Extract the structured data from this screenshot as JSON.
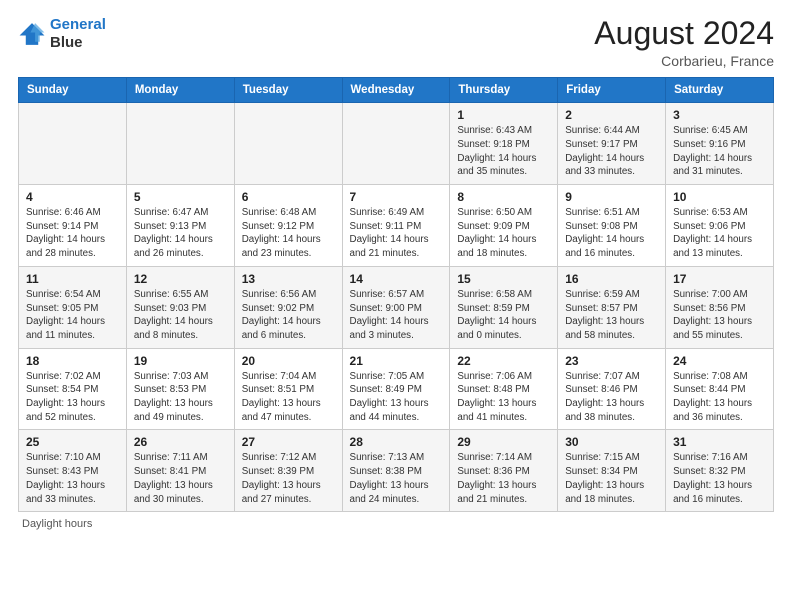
{
  "app": {
    "logo_line1": "General",
    "logo_line2": "Blue"
  },
  "header": {
    "title": "August 2024",
    "subtitle": "Corbarieu, France"
  },
  "weekdays": [
    "Sunday",
    "Monday",
    "Tuesday",
    "Wednesday",
    "Thursday",
    "Friday",
    "Saturday"
  ],
  "footer": {
    "note": "Daylight hours"
  },
  "weeks": [
    [
      {
        "day": "",
        "info": ""
      },
      {
        "day": "",
        "info": ""
      },
      {
        "day": "",
        "info": ""
      },
      {
        "day": "",
        "info": ""
      },
      {
        "day": "1",
        "info": "Sunrise: 6:43 AM\nSunset: 9:18 PM\nDaylight: 14 hours\nand 35 minutes."
      },
      {
        "day": "2",
        "info": "Sunrise: 6:44 AM\nSunset: 9:17 PM\nDaylight: 14 hours\nand 33 minutes."
      },
      {
        "day": "3",
        "info": "Sunrise: 6:45 AM\nSunset: 9:16 PM\nDaylight: 14 hours\nand 31 minutes."
      }
    ],
    [
      {
        "day": "4",
        "info": "Sunrise: 6:46 AM\nSunset: 9:14 PM\nDaylight: 14 hours\nand 28 minutes."
      },
      {
        "day": "5",
        "info": "Sunrise: 6:47 AM\nSunset: 9:13 PM\nDaylight: 14 hours\nand 26 minutes."
      },
      {
        "day": "6",
        "info": "Sunrise: 6:48 AM\nSunset: 9:12 PM\nDaylight: 14 hours\nand 23 minutes."
      },
      {
        "day": "7",
        "info": "Sunrise: 6:49 AM\nSunset: 9:11 PM\nDaylight: 14 hours\nand 21 minutes."
      },
      {
        "day": "8",
        "info": "Sunrise: 6:50 AM\nSunset: 9:09 PM\nDaylight: 14 hours\nand 18 minutes."
      },
      {
        "day": "9",
        "info": "Sunrise: 6:51 AM\nSunset: 9:08 PM\nDaylight: 14 hours\nand 16 minutes."
      },
      {
        "day": "10",
        "info": "Sunrise: 6:53 AM\nSunset: 9:06 PM\nDaylight: 14 hours\nand 13 minutes."
      }
    ],
    [
      {
        "day": "11",
        "info": "Sunrise: 6:54 AM\nSunset: 9:05 PM\nDaylight: 14 hours\nand 11 minutes."
      },
      {
        "day": "12",
        "info": "Sunrise: 6:55 AM\nSunset: 9:03 PM\nDaylight: 14 hours\nand 8 minutes."
      },
      {
        "day": "13",
        "info": "Sunrise: 6:56 AM\nSunset: 9:02 PM\nDaylight: 14 hours\nand 6 minutes."
      },
      {
        "day": "14",
        "info": "Sunrise: 6:57 AM\nSunset: 9:00 PM\nDaylight: 14 hours\nand 3 minutes."
      },
      {
        "day": "15",
        "info": "Sunrise: 6:58 AM\nSunset: 8:59 PM\nDaylight: 14 hours\nand 0 minutes."
      },
      {
        "day": "16",
        "info": "Sunrise: 6:59 AM\nSunset: 8:57 PM\nDaylight: 13 hours\nand 58 minutes."
      },
      {
        "day": "17",
        "info": "Sunrise: 7:00 AM\nSunset: 8:56 PM\nDaylight: 13 hours\nand 55 minutes."
      }
    ],
    [
      {
        "day": "18",
        "info": "Sunrise: 7:02 AM\nSunset: 8:54 PM\nDaylight: 13 hours\nand 52 minutes."
      },
      {
        "day": "19",
        "info": "Sunrise: 7:03 AM\nSunset: 8:53 PM\nDaylight: 13 hours\nand 49 minutes."
      },
      {
        "day": "20",
        "info": "Sunrise: 7:04 AM\nSunset: 8:51 PM\nDaylight: 13 hours\nand 47 minutes."
      },
      {
        "day": "21",
        "info": "Sunrise: 7:05 AM\nSunset: 8:49 PM\nDaylight: 13 hours\nand 44 minutes."
      },
      {
        "day": "22",
        "info": "Sunrise: 7:06 AM\nSunset: 8:48 PM\nDaylight: 13 hours\nand 41 minutes."
      },
      {
        "day": "23",
        "info": "Sunrise: 7:07 AM\nSunset: 8:46 PM\nDaylight: 13 hours\nand 38 minutes."
      },
      {
        "day": "24",
        "info": "Sunrise: 7:08 AM\nSunset: 8:44 PM\nDaylight: 13 hours\nand 36 minutes."
      }
    ],
    [
      {
        "day": "25",
        "info": "Sunrise: 7:10 AM\nSunset: 8:43 PM\nDaylight: 13 hours\nand 33 minutes."
      },
      {
        "day": "26",
        "info": "Sunrise: 7:11 AM\nSunset: 8:41 PM\nDaylight: 13 hours\nand 30 minutes."
      },
      {
        "day": "27",
        "info": "Sunrise: 7:12 AM\nSunset: 8:39 PM\nDaylight: 13 hours\nand 27 minutes."
      },
      {
        "day": "28",
        "info": "Sunrise: 7:13 AM\nSunset: 8:38 PM\nDaylight: 13 hours\nand 24 minutes."
      },
      {
        "day": "29",
        "info": "Sunrise: 7:14 AM\nSunset: 8:36 PM\nDaylight: 13 hours\nand 21 minutes."
      },
      {
        "day": "30",
        "info": "Sunrise: 7:15 AM\nSunset: 8:34 PM\nDaylight: 13 hours\nand 18 minutes."
      },
      {
        "day": "31",
        "info": "Sunrise: 7:16 AM\nSunset: 8:32 PM\nDaylight: 13 hours\nand 16 minutes."
      }
    ]
  ]
}
